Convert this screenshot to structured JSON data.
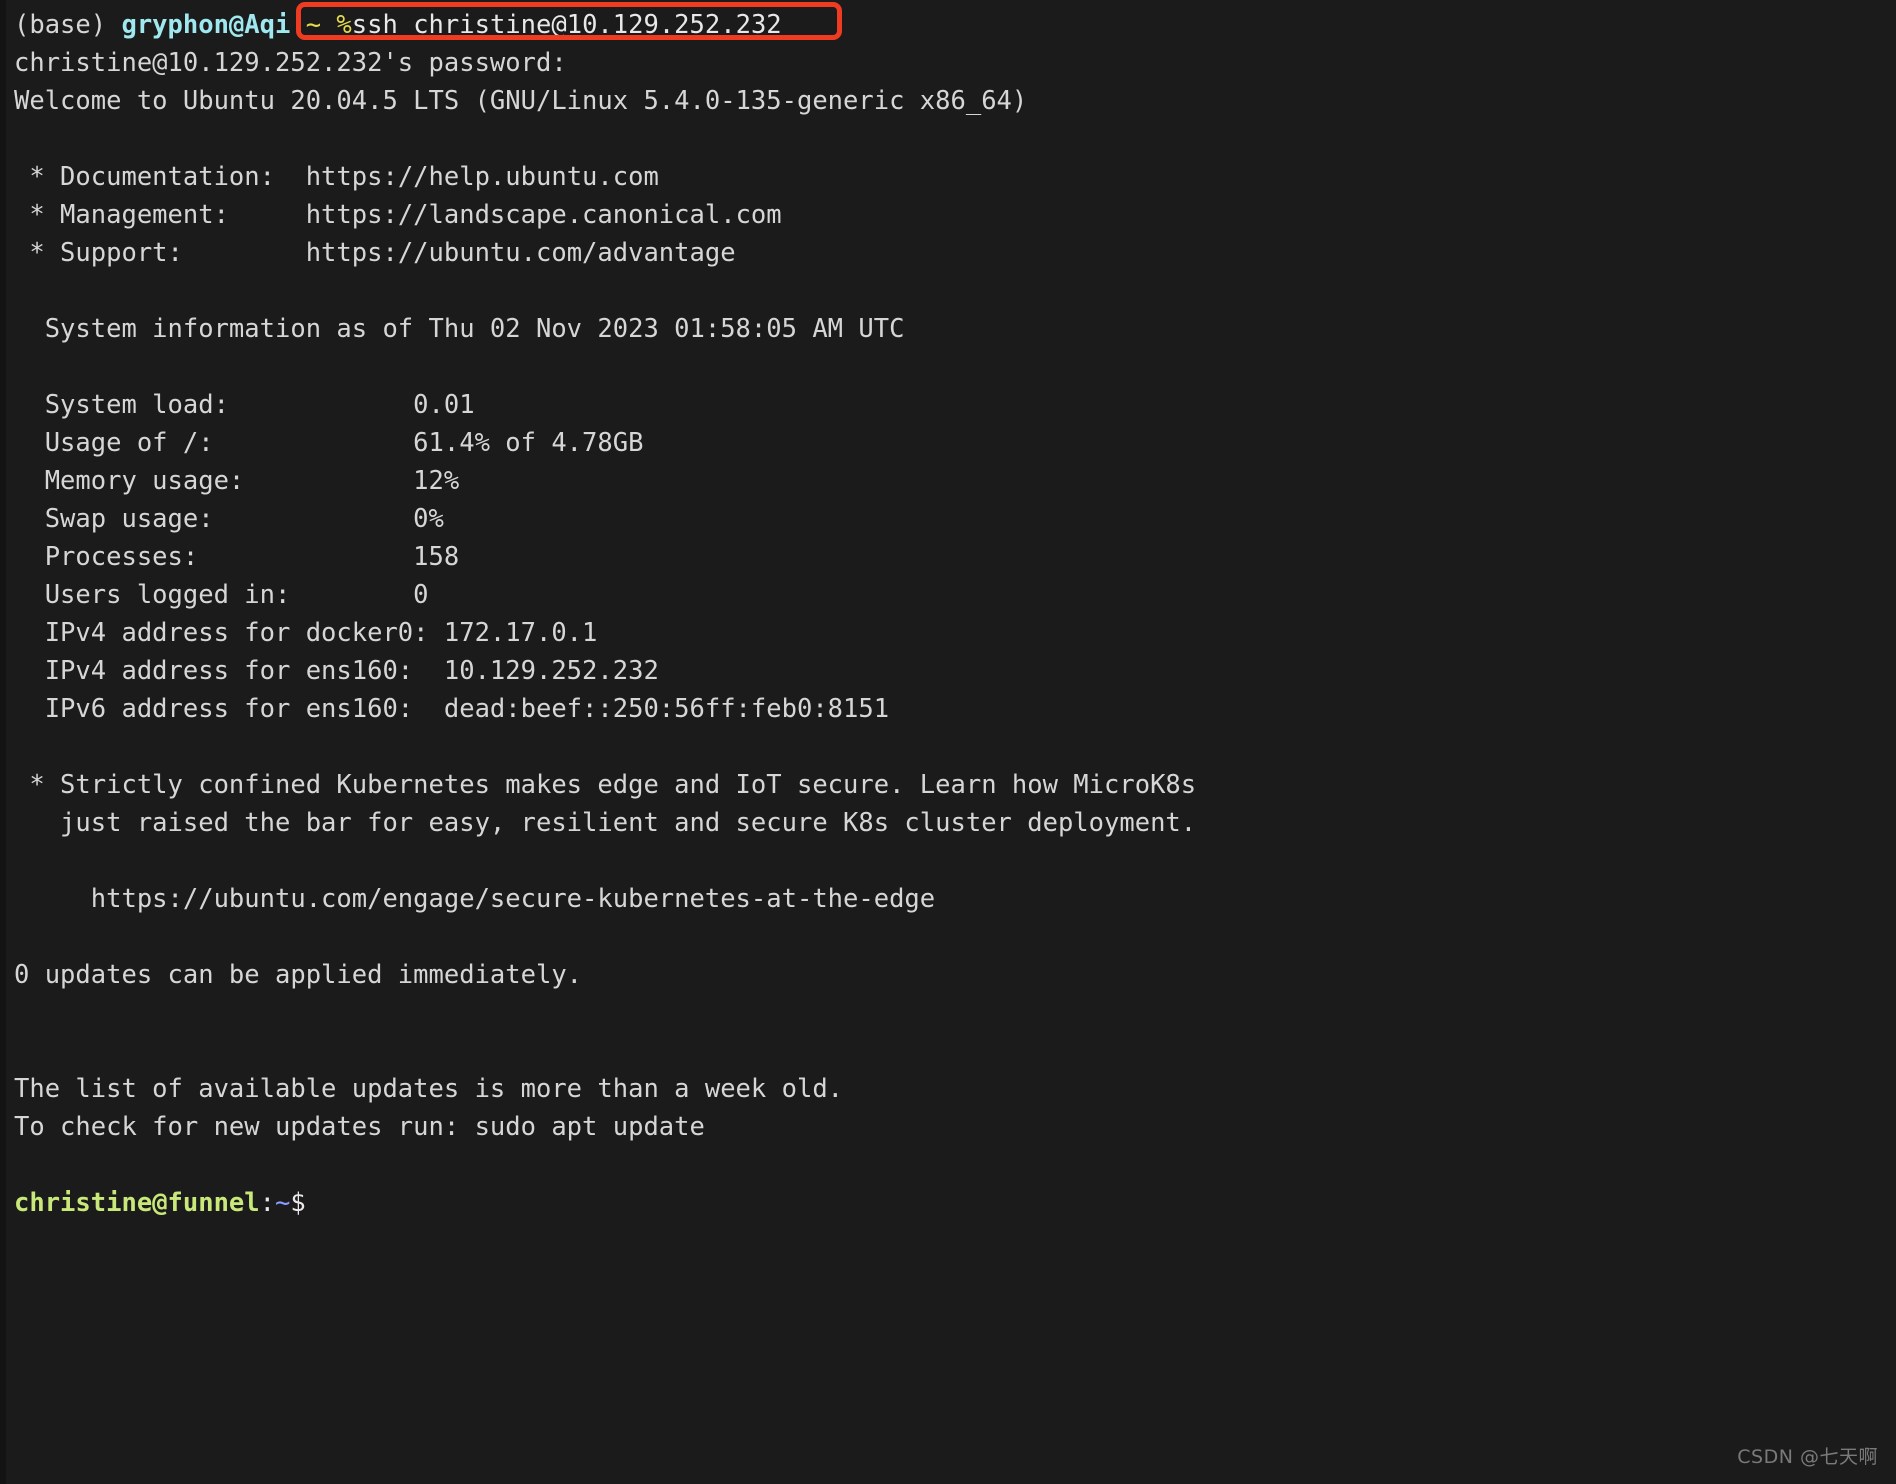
{
  "terminal": {
    "background_color": "#1b1b1b",
    "default_text_color": "#d6d6d6",
    "accent_highlight_color": "#ef3b21"
  },
  "local_prompt": {
    "env": "(base) ",
    "user_host": "gryphon@Aqi",
    "path": " ~ ",
    "symbol": "%",
    "command": "ssh christine@10.129.252.232"
  },
  "session": {
    "password_prompt": "christine@10.129.252.232's password:",
    "welcome": "Welcome to Ubuntu 20.04.5 LTS (GNU/Linux 5.4.0-135-generic x86_64)",
    "links": [
      {
        "label": " * Documentation:  ",
        "url": "https://help.ubuntu.com"
      },
      {
        "label": " * Management:     ",
        "url": "https://landscape.canonical.com"
      },
      {
        "label": " * Support:        ",
        "url": "https://ubuntu.com/advantage"
      }
    ],
    "sysinfo_header": "  System information as of Thu 02 Nov 2023 01:58:05 AM UTC",
    "sysinfo": [
      {
        "key": "  System load:  ",
        "pad": "              ",
        "value": "0.01"
      },
      {
        "key": "  Usage of /:   ",
        "pad": "              ",
        "value": "61.4% of 4.78GB"
      },
      {
        "key": "  Memory usage: ",
        "pad": "              ",
        "value": "12%"
      },
      {
        "key": "  Swap usage:   ",
        "pad": "              ",
        "value": "0%"
      },
      {
        "key": "  Processes:    ",
        "pad": "              ",
        "value": "158"
      },
      {
        "key": "  Users logged in:",
        "pad": "            ",
        "value": "0"
      },
      {
        "key": "  IPv4 address for docker0:",
        "pad": " ",
        "value": "172.17.0.1"
      },
      {
        "key": "  IPv4 address for ens160:",
        "pad": "  ",
        "value": "10.129.252.232"
      },
      {
        "key": "  IPv6 address for ens160:",
        "pad": "  ",
        "value": "dead:beef::250:56ff:feb0:8151"
      }
    ],
    "sysinfo_lines": [
      "  System load:            0.01",
      "  Usage of /:             61.4% of 4.78GB",
      "  Memory usage:           12%",
      "  Swap usage:             0%",
      "  Processes:              158",
      "  Users logged in:        0",
      "  IPv4 address for docker0: 172.17.0.1",
      "  IPv4 address for ens160:  10.129.252.232",
      "  IPv6 address for ens160:  dead:beef::250:56ff:feb0:8151"
    ],
    "notice_line1": " * Strictly confined Kubernetes makes edge and IoT secure. Learn how MicroK8s",
    "notice_line2": "   just raised the bar for easy, resilient and secure K8s cluster deployment.",
    "notice_url": "     https://ubuntu.com/engage/secure-kubernetes-at-the-edge",
    "updates_immediate": "0 updates can be applied immediately.",
    "updates_stale": "The list of available updates is more than a week old.",
    "updates_check": "To check for new updates run: sudo apt update"
  },
  "remote_prompt": {
    "user_host": "christine@funnel",
    "colon": ":",
    "path": "~",
    "symbol": "$"
  },
  "watermark": {
    "text": "CSDN @七天啊"
  }
}
